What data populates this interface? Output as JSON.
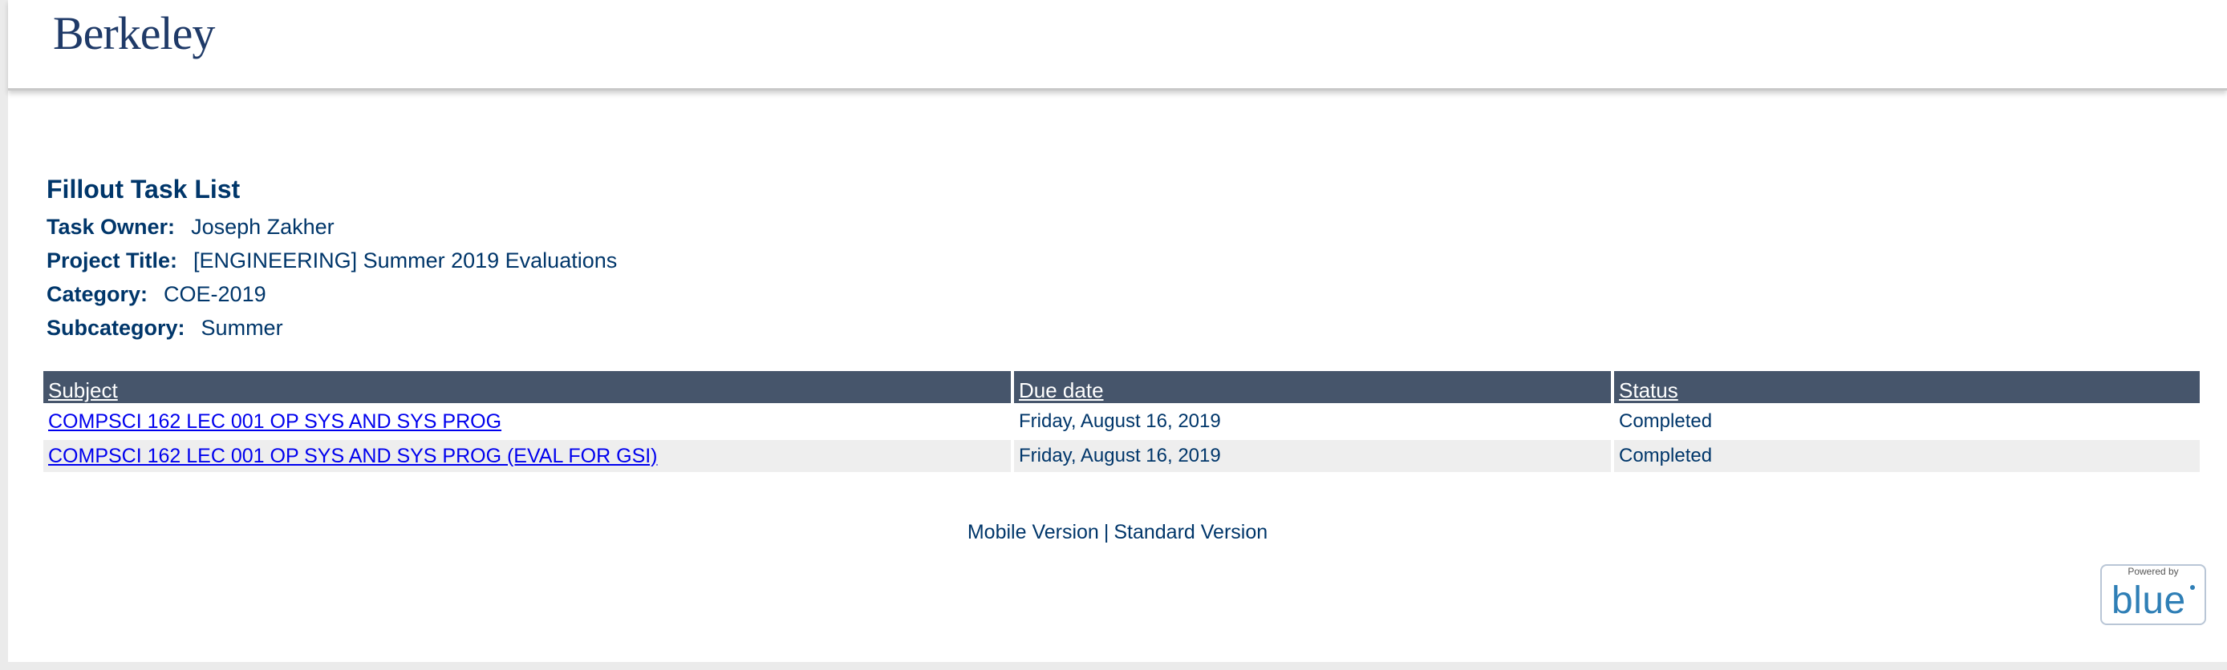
{
  "header": {
    "logo_text": "Berkeley"
  },
  "task_list": {
    "title": "Fillout Task List",
    "task_owner_label": "Task Owner:",
    "task_owner": "Joseph Zakher",
    "project_title_label": "Project Title:",
    "project_title": "[ENGINEERING] Summer 2019 Evaluations",
    "category_label": "Category:",
    "category": "COE-2019",
    "subcategory_label": "Subcategory:",
    "subcategory": "Summer"
  },
  "table": {
    "columns": [
      "Subject",
      "Due date",
      "Status"
    ],
    "rows": [
      {
        "subject": "COMPSCI 162 LEC 001 OP SYS AND SYS PROG",
        "due_date": "Friday, August 16, 2019",
        "status": "Completed"
      },
      {
        "subject": "COMPSCI 162 LEC 001 OP SYS AND SYS PROG (EVAL FOR GSI)",
        "due_date": "Friday, August 16, 2019",
        "status": "Completed"
      }
    ]
  },
  "footer": {
    "mobile_version": "Mobile Version",
    "separator": "|",
    "standard_version": "Standard Version"
  },
  "powered_by": {
    "label": "Powered by",
    "brand": "blue"
  },
  "colors": {
    "text_primary": "#00366a",
    "table_header_bg": "#46556b",
    "link": "#0000ee",
    "brand_blue": "#2f7fb6"
  }
}
